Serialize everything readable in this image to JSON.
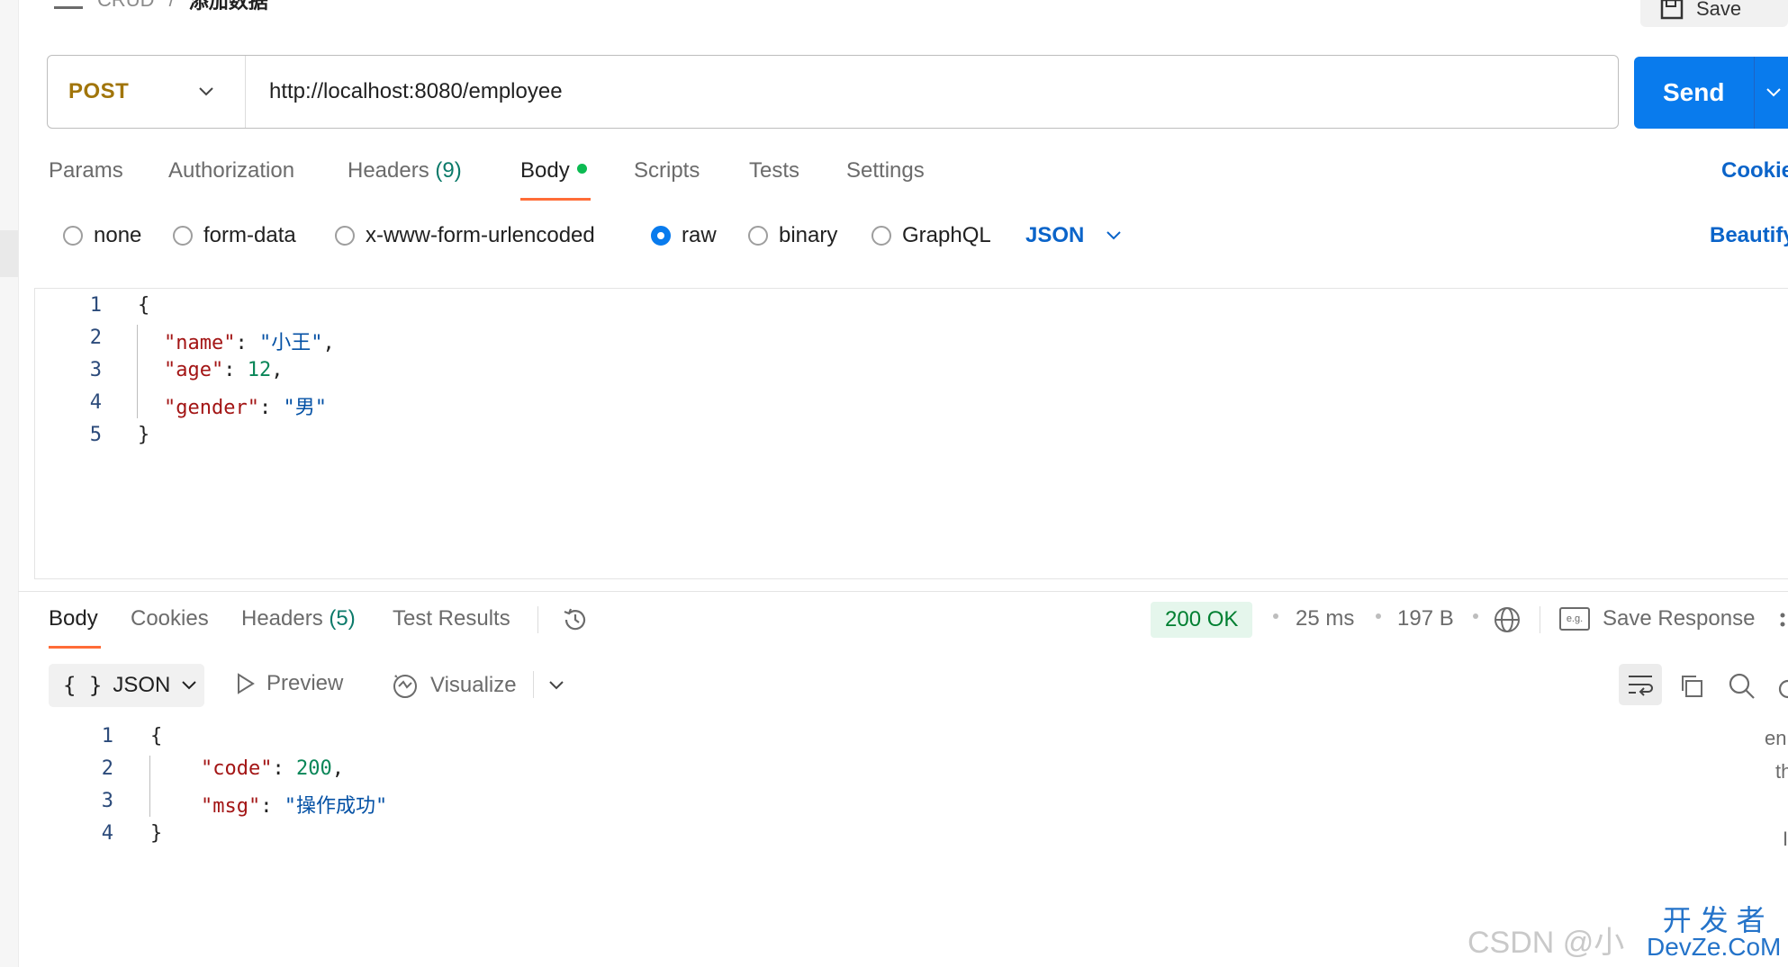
{
  "breadcrumb": {
    "collection": "CRUD",
    "separator": "/",
    "request": "添加数据"
  },
  "top_save_label": "Save",
  "request": {
    "method": "POST",
    "url": "http://localhost:8080/employee",
    "send_label": "Send"
  },
  "request_tabs": {
    "params": "Params",
    "authorization": "Authorization",
    "headers": "Headers",
    "headers_count": "(9)",
    "body": "Body",
    "scripts": "Scripts",
    "tests": "Tests",
    "settings": "Settings",
    "cookies": "Cookie"
  },
  "body_types": {
    "none": "none",
    "form_data": "form-data",
    "urlencoded": "x-www-form-urlencoded",
    "raw": "raw",
    "binary": "binary",
    "graphql": "GraphQL",
    "selected": "raw",
    "format": "JSON",
    "beautify": "Beautify"
  },
  "request_body": {
    "line_numbers": [
      "1",
      "2",
      "3",
      "4",
      "5"
    ],
    "open_brace": "{",
    "close_brace": "}",
    "k1": "\"name\"",
    "v1": "\"小王\"",
    "k2": "\"age\"",
    "v2": "12",
    "k3": "\"gender\"",
    "v3": "\"男\""
  },
  "response_tabs": {
    "body": "Body",
    "cookies": "Cookies",
    "headers": "Headers",
    "headers_count": "(5)",
    "test_results": "Test Results"
  },
  "response_meta": {
    "status": "200 OK",
    "time": "25 ms",
    "size": "197 B",
    "save_response": "Save Response",
    "eg_label": "e.g."
  },
  "response_toolbar": {
    "format": "JSON",
    "format_icon": "{ }",
    "preview": "Preview",
    "visualize": "Visualize"
  },
  "response_body": {
    "line_numbers": [
      "1",
      "2",
      "3",
      "4"
    ],
    "open_brace": "{",
    "close_brace": "}",
    "k1": "\"code\"",
    "v1": "200",
    "k2": "\"msg\"",
    "v2": "\"操作成功\""
  },
  "side_hint": {
    "l1": "en",
    "l2": "th",
    "l3": "I"
  },
  "watermark": {
    "text": "CSDN @小",
    "brand_line1": "开 发 者",
    "brand_line2": "DevZe.CoM"
  },
  "colors": {
    "accent": "#097bed",
    "method": "#a1750a",
    "status_ok": "#007f31",
    "tab_underline": "#ff6c37"
  }
}
